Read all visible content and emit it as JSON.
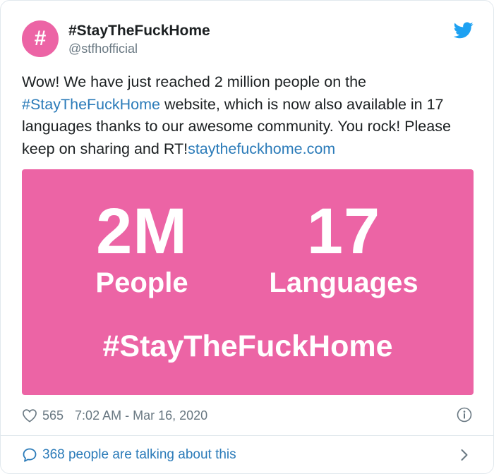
{
  "account": {
    "avatar_glyph": "#",
    "name": "#StayTheFuckHome",
    "handle": "@stfhofficial"
  },
  "tweet": {
    "text_part1": "Wow! We have just reached 2 million people on the ",
    "hashtag_link": "#StayTheFuckHome",
    "text_part2": " website, which is now also available in 17 languages thanks to our awesome community. You rock! Please keep on sharing and RT!",
    "url_link": "staythefuckhome.com"
  },
  "media": {
    "stat1_value": "2M",
    "stat1_label": "People",
    "stat2_value": "17",
    "stat2_label": "Languages",
    "hashtag": "#StayTheFuckHome",
    "background_color": "#ec64a5"
  },
  "meta": {
    "likes": "565",
    "timestamp": "7:02 AM - Mar 16, 2020"
  },
  "footer": {
    "talking": "368 people are talking about this"
  },
  "icons": {
    "brand": "twitter-bird-icon",
    "like": "heart-icon",
    "info": "info-icon",
    "reply": "speech-bubble-icon",
    "more": "chevron-right-icon"
  },
  "colors": {
    "link": "#2b7bb9",
    "twitter_blue": "#1da1f2",
    "muted": "#697882"
  }
}
